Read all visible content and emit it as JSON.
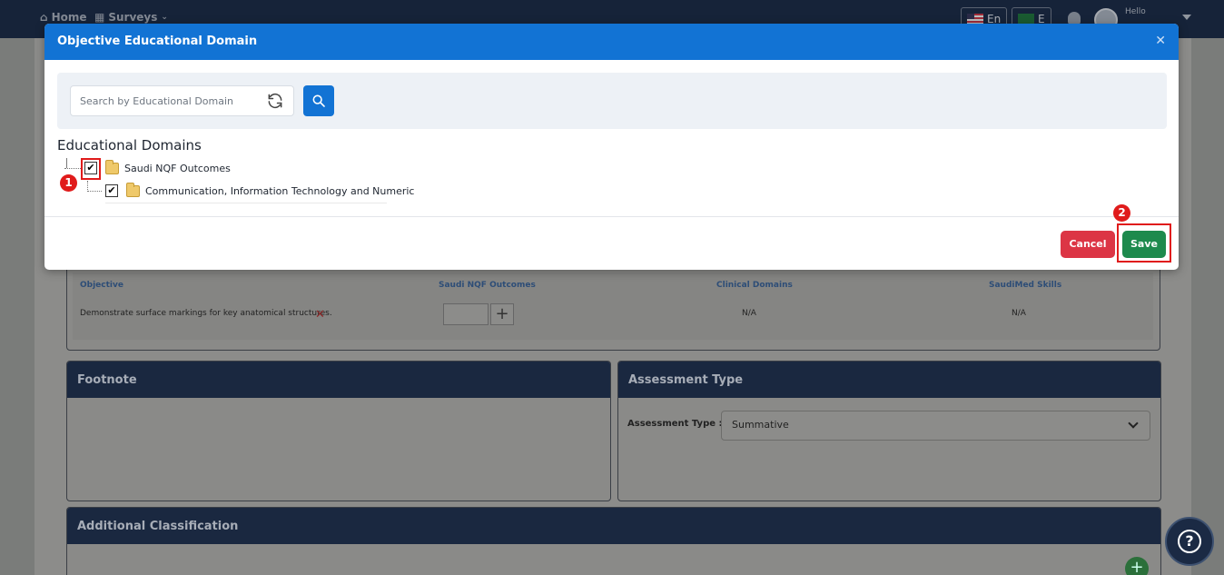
{
  "topbar": {
    "home_label": "Home",
    "surveys_label": "Surveys",
    "lang_en": "En",
    "lang_ar": "E",
    "user_greeting": "Hello"
  },
  "background": {
    "objectives_table": {
      "headers": [
        "Objective",
        "Saudi NQF Outcomes",
        "Clinical Domains",
        "SaudiMed Skills"
      ],
      "row": {
        "objective": "Demonstrate surface markings for key anatomical structures.",
        "clinical_domains": "N/A",
        "saudimed_skills": "N/A"
      }
    },
    "footnote_title": "Footnote",
    "assessment_type_title": "Assessment Type",
    "assessment_type_label": "Assessment Type :",
    "assessment_type_value": "Summative",
    "additional_classification_title": "Additional Classification"
  },
  "modal": {
    "title": "Objective Educational Domain",
    "search_placeholder": "Search by Educational Domain",
    "tree_title": "Educational Domains",
    "tree": [
      {
        "label": "Saudi NQF Outcomes",
        "checked": true
      },
      {
        "label": "Communication, Information Technology and Numeric",
        "checked": true
      }
    ],
    "cancel_label": "Cancel",
    "save_label": "Save"
  },
  "annotations": {
    "step1": "1",
    "step2": "2",
    "highlight_color": "#e01b1b"
  },
  "colors": {
    "primary": "#1273d4",
    "danger": "#dc3545",
    "success": "#1d8a4d",
    "navy": "#1b2a44"
  }
}
